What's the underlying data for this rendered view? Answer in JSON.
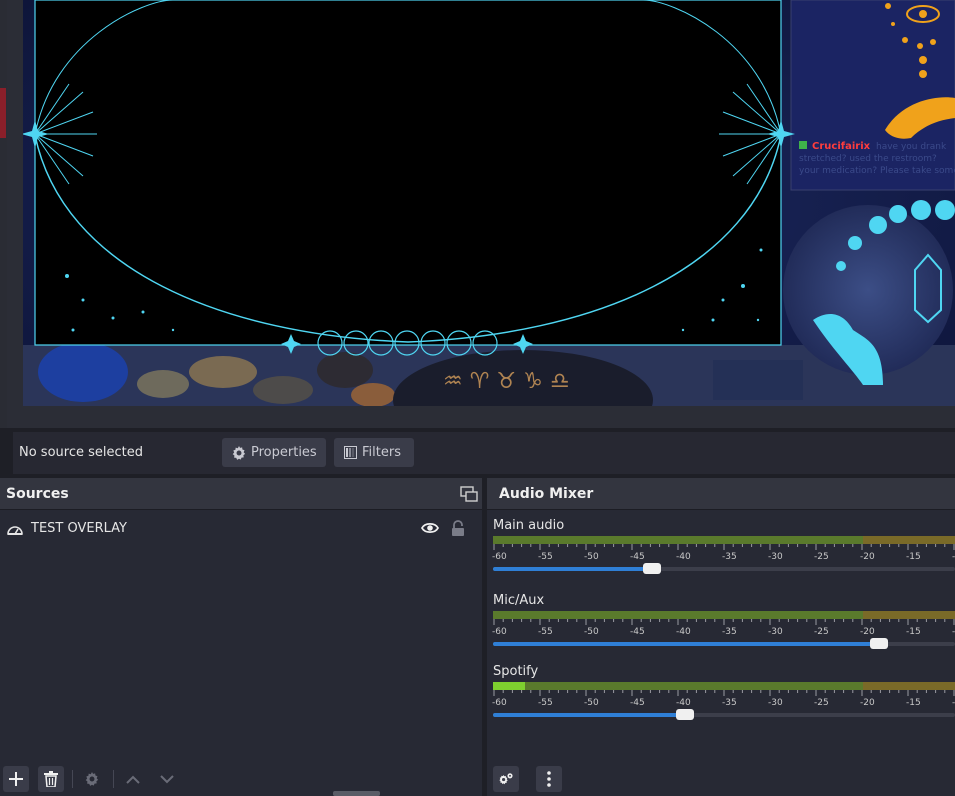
{
  "context_bar": {
    "no_source_label": "No source selected",
    "properties_label": "Properties",
    "filters_label": "Filters"
  },
  "overlay": {
    "chat_user": "Crucifairix",
    "chat_message": "have you drank water? stretched? used the restroom? taken your medication? Please take some"
  },
  "sources": {
    "title": "Sources",
    "items": [
      {
        "name": "TEST OVERLAY",
        "visible": true,
        "locked": false
      }
    ]
  },
  "mixer": {
    "title": "Audio Mixer",
    "tick_labels": [
      "-60",
      "-55",
      "-50",
      "-45",
      "-40",
      "-35",
      "-30",
      "-25",
      "-20",
      "-15",
      "-"
    ],
    "channels": [
      {
        "name": "Main audio",
        "volume_fraction": 0.345,
        "level_fraction": 0.0
      },
      {
        "name": "Mic/Aux",
        "volume_fraction": 0.835,
        "level_fraction": 0.0
      },
      {
        "name": "Spotify",
        "volume_fraction": 0.415,
        "level_fraction": 0.07
      }
    ]
  },
  "colors": {
    "accent_blue": "#2f7fd6",
    "overlay_cyan": "#4fd6f2",
    "overlay_gold": "#f0a21b",
    "chat_name_red": "#ff3d3d"
  },
  "icons": [
    "gear-icon",
    "filter-icon",
    "dock-float-icon",
    "source-type-icon",
    "eye-icon",
    "lock-icon",
    "plus-icon",
    "trash-icon",
    "up-arrow-icon",
    "down-arrow-icon",
    "kebab-icon"
  ]
}
